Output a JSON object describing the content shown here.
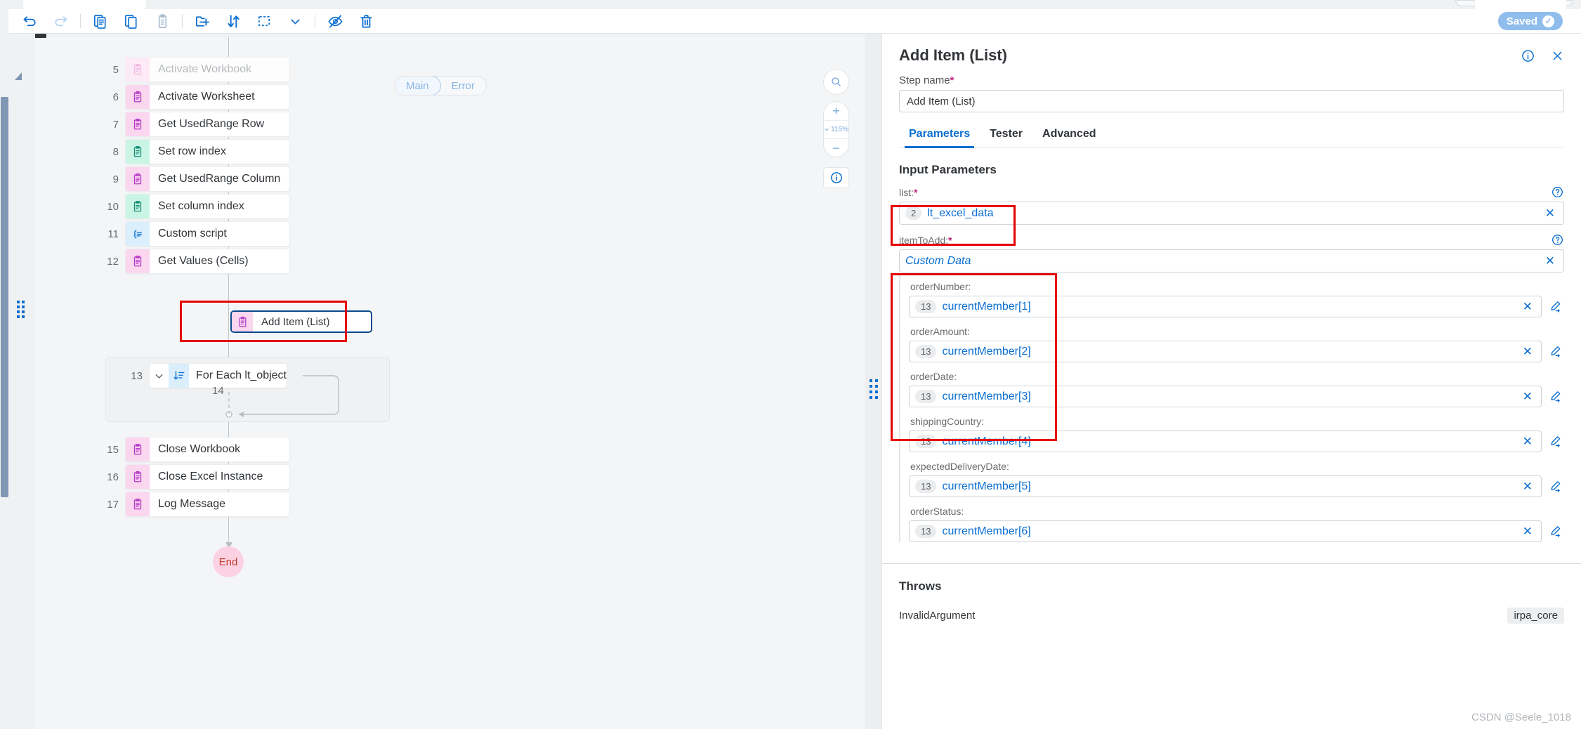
{
  "toolbar": {
    "buttons": [
      {
        "name": "undo-icon",
        "label": "Undo"
      },
      {
        "name": "redo-icon",
        "label": "Redo"
      },
      {
        "name": "copy-icon",
        "label": "Copy"
      },
      {
        "name": "duplicate-icon",
        "label": "Duplicate"
      },
      {
        "name": "paste-icon",
        "label": "Paste"
      },
      {
        "name": "new-group-icon",
        "label": "New Group"
      },
      {
        "name": "sort-icon",
        "label": "Sort"
      },
      {
        "name": "select-area-icon",
        "label": "Select Area"
      },
      {
        "name": "chevron-down-icon",
        "label": "More"
      },
      {
        "name": "hide-icon",
        "label": "Hide"
      },
      {
        "name": "delete-icon",
        "label": "Delete"
      }
    ],
    "saved_label": "Saved"
  },
  "canvas": {
    "branch_tabs": [
      {
        "label": "Main",
        "active": true
      },
      {
        "label": "Error",
        "active": false
      }
    ],
    "zoom_level": "115%",
    "controls": [
      {
        "name": "search-icon",
        "label": "Search"
      },
      {
        "name": "zoom-in-icon",
        "label": "+"
      },
      {
        "name": "zoom-out-icon",
        "label": "−"
      },
      {
        "name": "info-icon",
        "label": "Info"
      }
    ],
    "steps": [
      {
        "num": "5",
        "label": "Activate Workbook",
        "icon": "clipboard-icon",
        "tone": "pink-l",
        "ghost": true
      },
      {
        "num": "6",
        "label": "Activate Worksheet",
        "icon": "clipboard-icon",
        "tone": "pink",
        "ghost": false
      },
      {
        "num": "7",
        "label": "Get UsedRange Row",
        "icon": "clipboard-icon",
        "tone": "pink",
        "ghost": false
      },
      {
        "num": "8",
        "label": "Set row index",
        "icon": "clipboard-icon",
        "tone": "mint",
        "ghost": false
      },
      {
        "num": "9",
        "label": "Get UsedRange Column",
        "icon": "clipboard-icon",
        "tone": "pink",
        "ghost": false
      },
      {
        "num": "10",
        "label": "Set column index",
        "icon": "clipboard-icon",
        "tone": "mint",
        "ghost": false
      },
      {
        "num": "11",
        "label": "Custom script",
        "icon": "script-icon",
        "tone": "blue",
        "ghost": false
      },
      {
        "num": "12",
        "label": "Get Values (Cells)",
        "icon": "clipboard-icon",
        "tone": "pink",
        "ghost": false
      }
    ],
    "loop": {
      "num": "13",
      "label": "For Each lt_object",
      "icon": "foreach-icon",
      "child_num": "14",
      "child_label": "Add Item (List)",
      "child_icon": "clipboard-icon"
    },
    "steps_after": [
      {
        "num": "15",
        "label": "Close Workbook",
        "icon": "clipboard-icon",
        "tone": "pink"
      },
      {
        "num": "16",
        "label": "Close Excel Instance",
        "icon": "clipboard-icon",
        "tone": "pink"
      },
      {
        "num": "17",
        "label": "Log Message",
        "icon": "clipboard-icon",
        "tone": "pink"
      }
    ],
    "end_label": "End"
  },
  "panel": {
    "title": "Add Item (List)",
    "header_icons": [
      {
        "name": "info-icon",
        "label": "Information"
      },
      {
        "name": "close-icon",
        "label": "Close"
      }
    ],
    "step_name_label": "Step name",
    "step_name_value": "Add Item (List)",
    "tabs": [
      {
        "label": "Parameters",
        "active": true
      },
      {
        "label": "Tester",
        "active": false
      },
      {
        "label": "Advanced",
        "active": false
      }
    ],
    "input_parameters_title": "Input Parameters",
    "params": [
      {
        "label": "list:",
        "required": true,
        "chip": "2",
        "value": "lt_excel_data",
        "italic": false
      },
      {
        "label": "itemToAdd:",
        "required": true,
        "chip": "",
        "value": "Custom Data",
        "italic": true
      }
    ],
    "subfields": [
      {
        "label": "orderNumber:",
        "chip": "13",
        "value": "currentMember[1]"
      },
      {
        "label": "orderAmount:",
        "chip": "13",
        "value": "currentMember[2]"
      },
      {
        "label": "orderDate:",
        "chip": "13",
        "value": "currentMember[3]"
      },
      {
        "label": "shippingCountry:",
        "chip": "13",
        "value": "currentMember[4]"
      },
      {
        "label": "expectedDeliveryDate:",
        "chip": "13",
        "value": "currentMember[5]"
      },
      {
        "label": "orderStatus:",
        "chip": "13",
        "value": "currentMember[6]"
      }
    ],
    "throws_title": "Throws",
    "throws": [
      {
        "name": "InvalidArgument",
        "tag": "irpa_core"
      }
    ],
    "clear_symbol": "✕"
  },
  "watermark": "CSDN @Seele_1018",
  "colors": {
    "accent": "#0a6ed1",
    "highlight": "#e60000",
    "selected_border": "#0a4b8c",
    "required": "#c0267e",
    "saved_bg": "#8fbdec"
  }
}
